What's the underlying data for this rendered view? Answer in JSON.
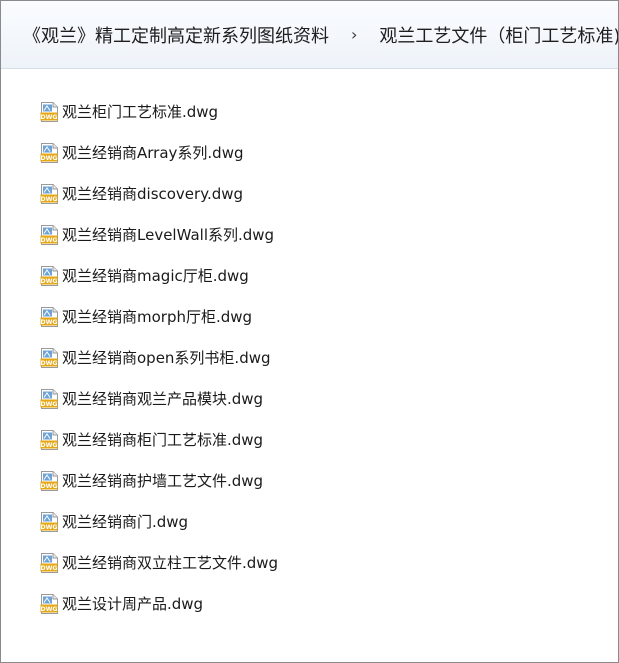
{
  "breadcrumb": {
    "parent": "《观兰》精工定制高定新系列图纸资料",
    "separator": "›",
    "current": "观兰工艺文件（柜门工艺标准)"
  },
  "icon": {
    "name": "dwg-file-icon",
    "label": "DWG"
  },
  "files": [
    "观兰柜门工艺标准.dwg",
    "观兰经销商Array系列.dwg",
    "观兰经销商discovery.dwg",
    "观兰经销商LevelWall系列.dwg",
    "观兰经销商magic厅柜.dwg",
    "观兰经销商morph厅柜.dwg",
    "观兰经销商open系列书柜.dwg",
    "观兰经销商观兰产品模块.dwg",
    "观兰经销商柜门工艺标准.dwg",
    "观兰经销商护墙工艺文件.dwg",
    "观兰经销商门.dwg",
    "观兰经销商双立柱工艺文件.dwg",
    "观兰设计周产品.dwg"
  ]
}
